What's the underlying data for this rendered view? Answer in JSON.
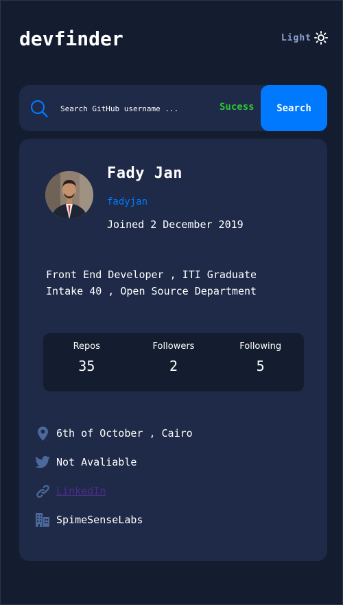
{
  "app": {
    "title": "devfinder",
    "theme_label": "Light"
  },
  "search": {
    "placeholder": "Search GitHub username ...",
    "value": "",
    "status": "Sucess",
    "button_label": "Search"
  },
  "profile": {
    "name": "Fady Jan",
    "username": "fadyjan",
    "joined": "Joined 2 December 2019",
    "bio": "Front End Developer , ITI Graduate\nIntake 40 , Open Source Department"
  },
  "stats": [
    {
      "label": "Repos",
      "value": "35"
    },
    {
      "label": "Followers",
      "value": "2"
    },
    {
      "label": "Following",
      "value": "5"
    }
  ],
  "links": {
    "location": {
      "icon": "location-pin-icon",
      "text": "6th of October , Cairo"
    },
    "twitter": {
      "icon": "twitter-icon",
      "text": "Not Avaliable"
    },
    "website": {
      "icon": "link-icon",
      "text": "LinkedIn"
    },
    "company": {
      "icon": "building-icon",
      "text": "SpimeSenseLabs"
    }
  },
  "colors": {
    "background": "#141d2f",
    "card": "#1e2a47",
    "accent": "#0079ff",
    "success": "#2fc238",
    "muted": "#90a4d4",
    "icon": "#4b6a9b"
  }
}
